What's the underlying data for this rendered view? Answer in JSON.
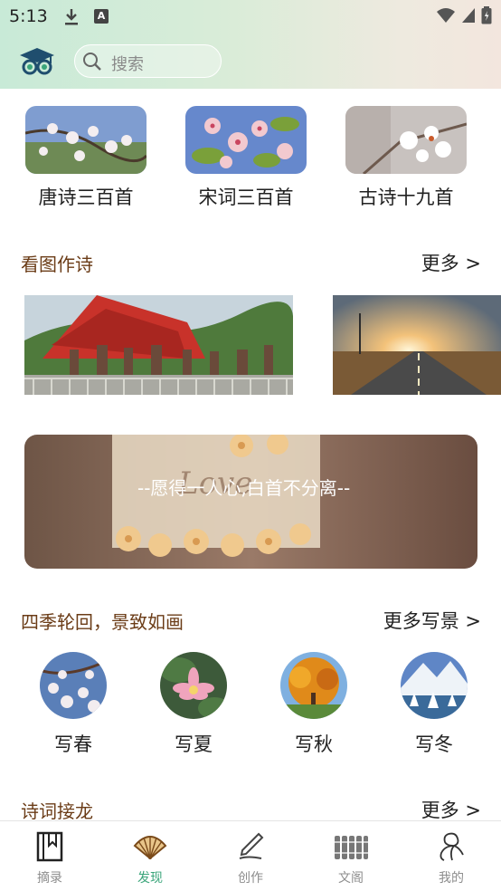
{
  "status_bar": {
    "time": "5:13"
  },
  "search": {
    "placeholder": "搜索"
  },
  "collections": [
    {
      "label": "唐诗三百首"
    },
    {
      "label": "宋词三百首"
    },
    {
      "label": "古诗十九首"
    }
  ],
  "picture_poem": {
    "title": "看图作诗",
    "more": "更多 >"
  },
  "banner": {
    "quote": "--愿得一人心,白首不分离--"
  },
  "seasons": {
    "title": "四季轮回，景致如画",
    "more": "更多写景 >",
    "items": [
      {
        "label": "写春"
      },
      {
        "label": "写夏"
      },
      {
        "label": "写秋"
      },
      {
        "label": "写冬"
      }
    ]
  },
  "relay": {
    "title": "诗词接龙",
    "more": "更多 >"
  },
  "bottom_nav": [
    {
      "label": "摘录",
      "icon": "bookmark-book-icon"
    },
    {
      "label": "发现",
      "icon": "fan-icon"
    },
    {
      "label": "创作",
      "icon": "pen-icon"
    },
    {
      "label": "文阁",
      "icon": "bamboo-scroll-icon"
    },
    {
      "label": "我的",
      "icon": "person-icon"
    }
  ],
  "colors": {
    "accent": "#3aa57a",
    "section_title": "#6b3c17"
  }
}
